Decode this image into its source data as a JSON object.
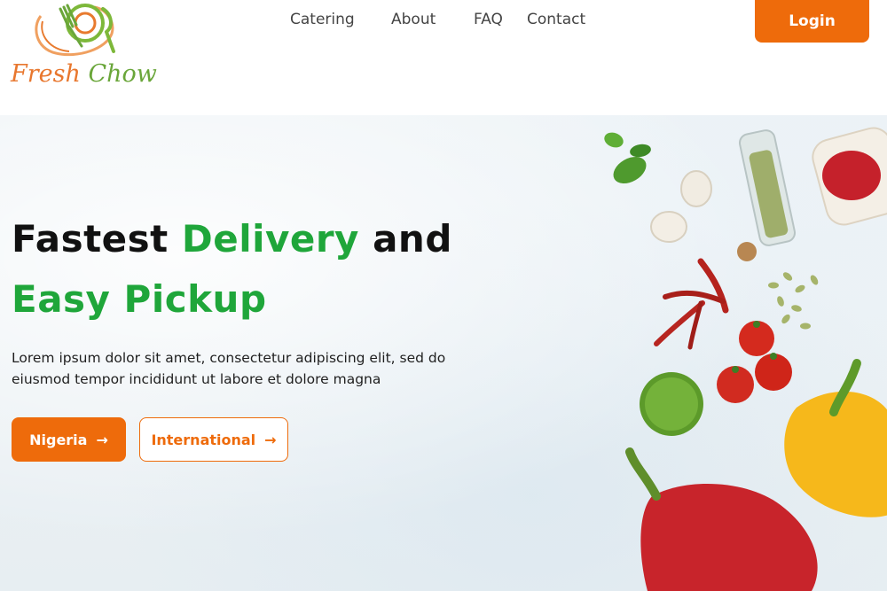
{
  "brand": {
    "logo_word1": "Fresh",
    "logo_word2": "Chow"
  },
  "nav": {
    "items": [
      "Catering",
      "About",
      "FAQ",
      "Contact"
    ],
    "login_label": "Login"
  },
  "hero": {
    "headline": {
      "line1_part1": "Fastest",
      "line1_part2": "Delivery",
      "line1_part3": "and",
      "line2": "Easy Pickup"
    },
    "description": "Lorem ipsum dolor sit amet, consectetur adipiscing elit, sed do eiusmod tempor incididunt ut labore et dolore magna",
    "buttons": {
      "primary": "Nigeria",
      "secondary": "International",
      "arrow": "→"
    }
  },
  "colors": {
    "accent_orange": "#ee6b0b",
    "brand_green": "#1fa63a",
    "text_dark": "#111111"
  },
  "icons": [
    "logo-plate-fork-icon",
    "arrow-right-icon"
  ]
}
